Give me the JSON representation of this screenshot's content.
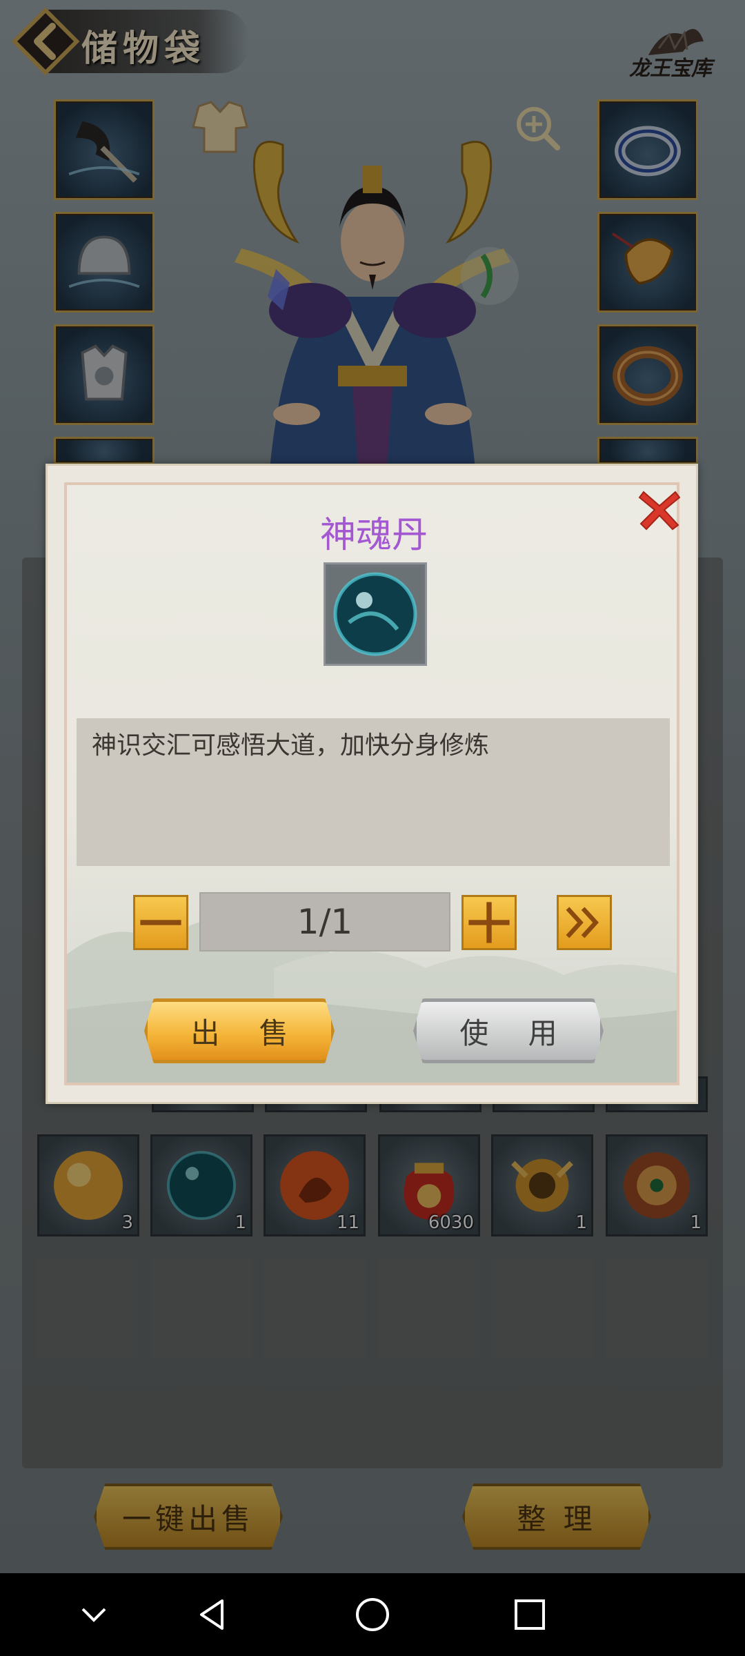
{
  "header": {
    "title": "储物袋",
    "treasury_label": "龙王宝库"
  },
  "dialog": {
    "item_name": "神魂丹",
    "description": "神识交汇可感悟大道，加快分身修炼",
    "quantity": "1/1",
    "sell_label": "出 售",
    "use_label": "使 用"
  },
  "inventory": {
    "items": [
      {
        "icon": "golden-orb-icon",
        "count": "3"
      },
      {
        "icon": "teal-orb-icon",
        "count": "1"
      },
      {
        "icon": "fire-beast-orb-icon",
        "count": "11"
      },
      {
        "icon": "grain-sack-icon",
        "count": "6030"
      },
      {
        "icon": "golden-charm-icon",
        "count": "1"
      },
      {
        "icon": "bronze-disc-icon",
        "count": "1"
      }
    ]
  },
  "bottom_bar": {
    "sell_all_label": "一键出售",
    "sort_label": "整 理"
  },
  "colors": {
    "item_name": "#a358d1",
    "close": "#d9372a",
    "gold": "#f5b63a"
  }
}
